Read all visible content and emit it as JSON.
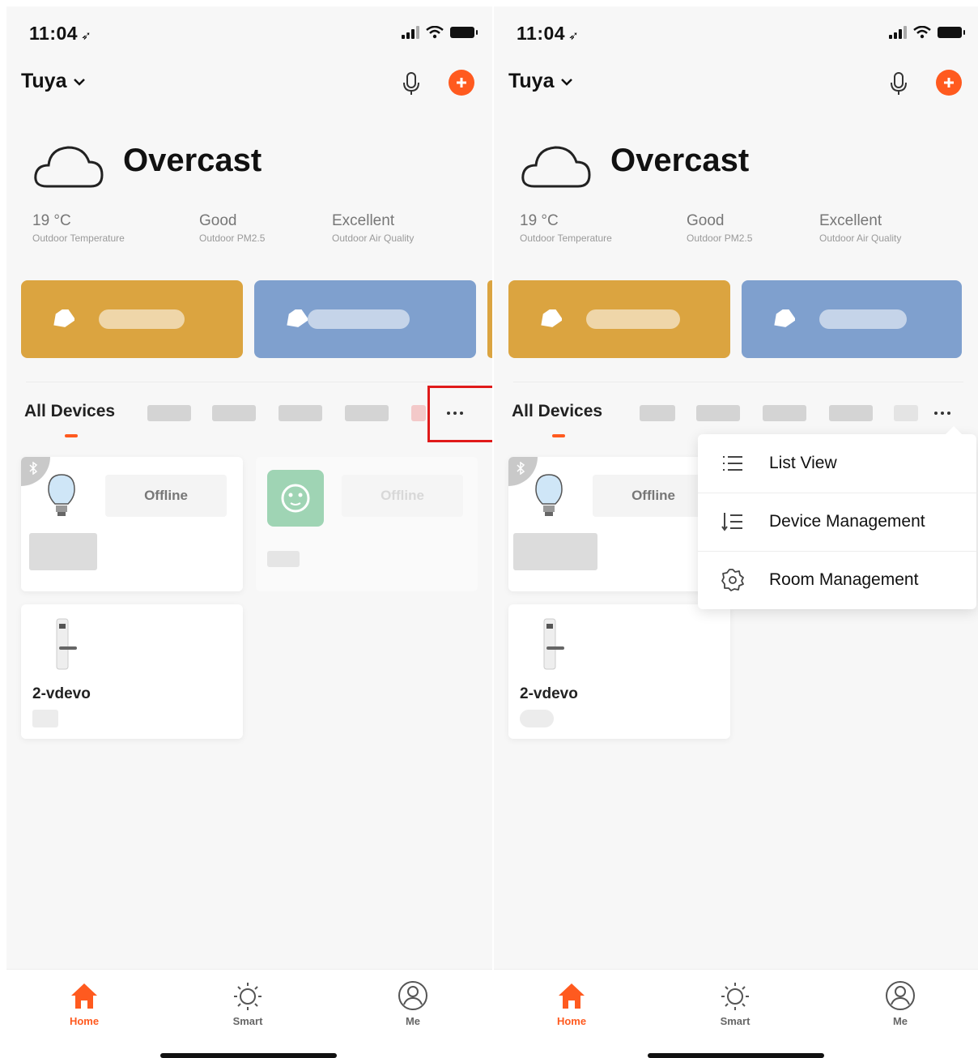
{
  "status": {
    "time": "11:04",
    "location_glyph": "➶"
  },
  "header": {
    "home_name": "Tuya"
  },
  "weather": {
    "condition": "Overcast",
    "stats": [
      {
        "value": "19 °C",
        "label": "Outdoor Temperature"
      },
      {
        "value": "Good",
        "label": "Outdoor PM2.5"
      },
      {
        "value": "Excellent",
        "label": "Outdoor Air Quality"
      }
    ]
  },
  "scenes": [
    {
      "color": "#dba440"
    },
    {
      "color": "#7fa0ce"
    }
  ],
  "tabs": {
    "all_devices": "All Devices"
  },
  "devices": [
    {
      "name": "",
      "status": "Offline",
      "icon": "bulb-icon"
    },
    {
      "name": "",
      "status": "Offline",
      "icon": "socket-icon"
    },
    {
      "name": "2-vdevo",
      "status": "",
      "icon": "door-lock-icon"
    }
  ],
  "menu": {
    "items": [
      {
        "label": "List View",
        "icon": "list-icon"
      },
      {
        "label": "Device Management",
        "icon": "sort-list-icon"
      },
      {
        "label": "Room Management",
        "icon": "gear-icon"
      }
    ]
  },
  "tabbar": {
    "items": [
      {
        "label": "Home",
        "icon": "home-icon",
        "active": true
      },
      {
        "label": "Smart",
        "icon": "sun-icon",
        "active": false
      },
      {
        "label": "Me",
        "icon": "user-icon",
        "active": false
      }
    ]
  },
  "colors": {
    "accent": "#ff5a1f",
    "highlight_box": "#e01a1a"
  }
}
